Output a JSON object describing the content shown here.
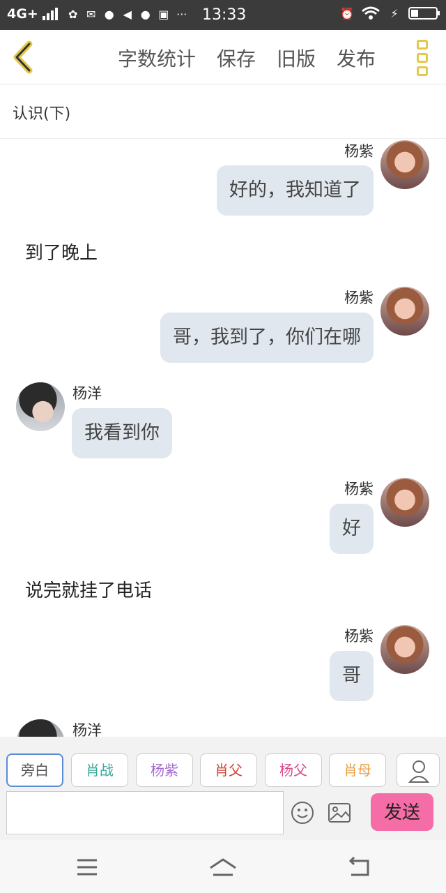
{
  "status_bar": {
    "network": "4G+",
    "time": "13:33"
  },
  "toolbar": {
    "word_count": "字数统计",
    "save": "保存",
    "old_version": "旧版",
    "publish": "发布"
  },
  "chapter_title": "认识(下)",
  "chat": [
    {
      "type": "right",
      "name": "杨紫",
      "text": "好的，我知道了"
    },
    {
      "type": "narration",
      "text": "到了晚上"
    },
    {
      "type": "right",
      "name": "杨紫",
      "text": "哥，我到了，你们在哪"
    },
    {
      "type": "left",
      "name": "杨洋",
      "text": "我看到你"
    },
    {
      "type": "right",
      "name": "杨紫",
      "text": "好"
    },
    {
      "type": "narration",
      "text": "说完就挂了电话"
    },
    {
      "type": "right",
      "name": "杨紫",
      "text": "哥"
    },
    {
      "type": "left",
      "name": "杨洋",
      "text": ""
    }
  ],
  "roles": [
    {
      "label": "旁白",
      "color": "#555555"
    },
    {
      "label": "肖战",
      "color": "#3aa89a"
    },
    {
      "label": "杨紫",
      "color": "#a56ad0"
    },
    {
      "label": "肖父",
      "color": "#d0453a"
    },
    {
      "label": "杨父",
      "color": "#d94b8c"
    },
    {
      "label": "肖母",
      "color": "#e8a24a"
    }
  ],
  "composer": {
    "placeholder": "",
    "send_label": "发送"
  },
  "colors": {
    "bubble": "#e1e7ee",
    "send": "#f56da6",
    "more_icon": "#e5c84a"
  }
}
